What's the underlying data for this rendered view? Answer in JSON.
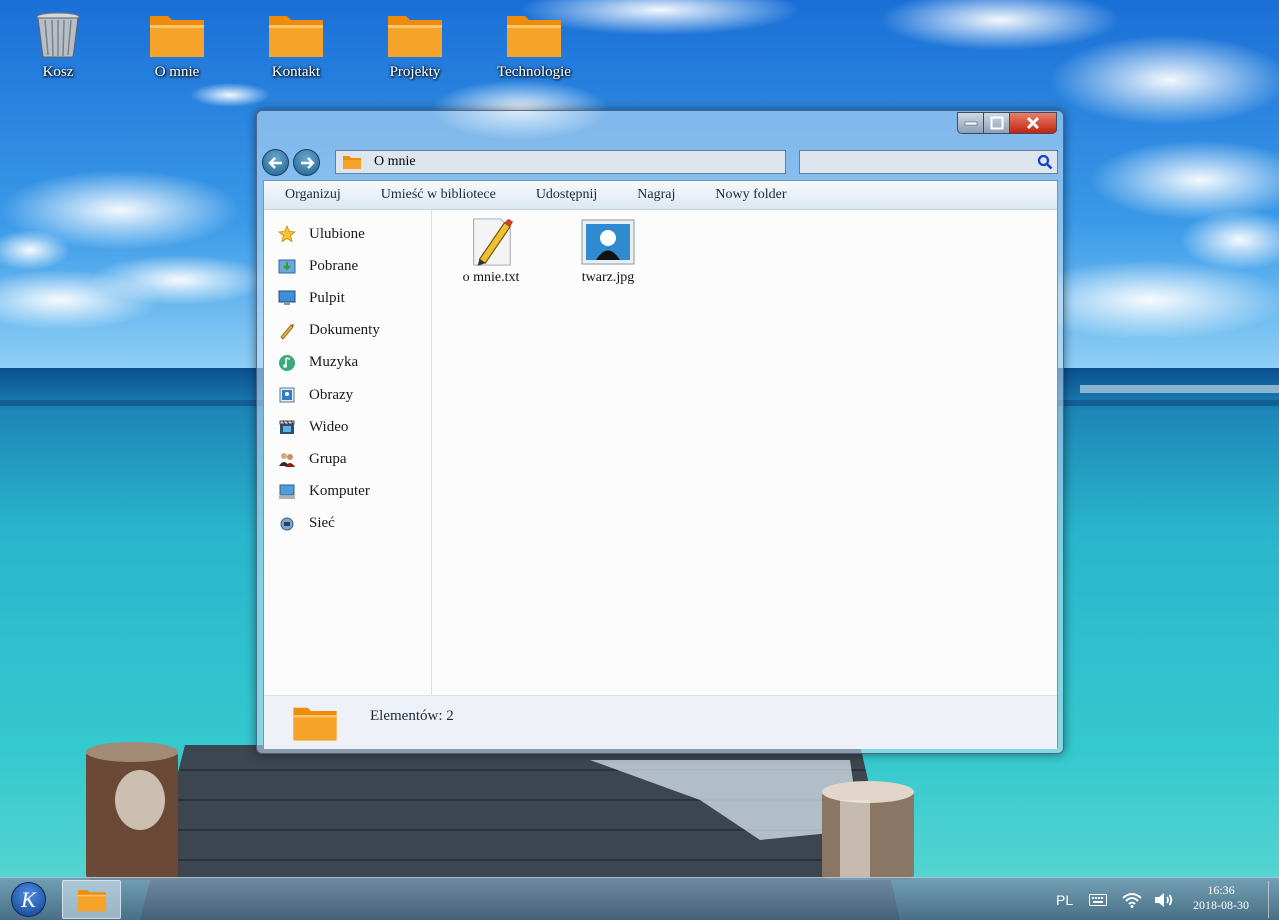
{
  "desktop": {
    "icons": [
      {
        "label": "Kosz",
        "icon": "recycle-bin-icon"
      },
      {
        "label": "O mnie",
        "icon": "folder-icon"
      },
      {
        "label": "Kontakt",
        "icon": "folder-icon"
      },
      {
        "label": "Projekty",
        "icon": "folder-icon"
      },
      {
        "label": "Technologie",
        "icon": "folder-icon"
      }
    ]
  },
  "window": {
    "address": "O mnie",
    "search": {
      "value": "",
      "placeholder": ""
    },
    "toolbar": [
      "Organizuj",
      "Umieść w bibliotece",
      "Udostępnij",
      "Nagraj",
      "Nowy folder"
    ],
    "sidebar": [
      {
        "label": "Ulubione",
        "icon": "star-icon"
      },
      {
        "label": "Pobrane",
        "icon": "download-icon"
      },
      {
        "label": "Pulpit",
        "icon": "desktop-icon"
      },
      {
        "label": "Dokumenty",
        "icon": "documents-icon"
      },
      {
        "label": "Muzyka",
        "icon": "music-icon"
      },
      {
        "label": "Obrazy",
        "icon": "pictures-icon"
      },
      {
        "label": "Wideo",
        "icon": "video-icon"
      },
      {
        "label": "Grupa",
        "icon": "group-icon"
      },
      {
        "label": "Komputer",
        "icon": "computer-icon"
      },
      {
        "label": "Sieć",
        "icon": "network-icon"
      }
    ],
    "files": [
      {
        "name": "o mnie.txt",
        "icon": "text-file-icon"
      },
      {
        "name": "twarz.jpg",
        "icon": "image-file-icon"
      }
    ],
    "status": "Elementów: 2"
  },
  "taskbar": {
    "start_label": "K",
    "language": "PL",
    "time": "16:36",
    "date": "2018-08-30"
  },
  "colors": {
    "folder": "#f6a32a",
    "close_button": "#d5361c",
    "accent": "#1d5f8e"
  }
}
